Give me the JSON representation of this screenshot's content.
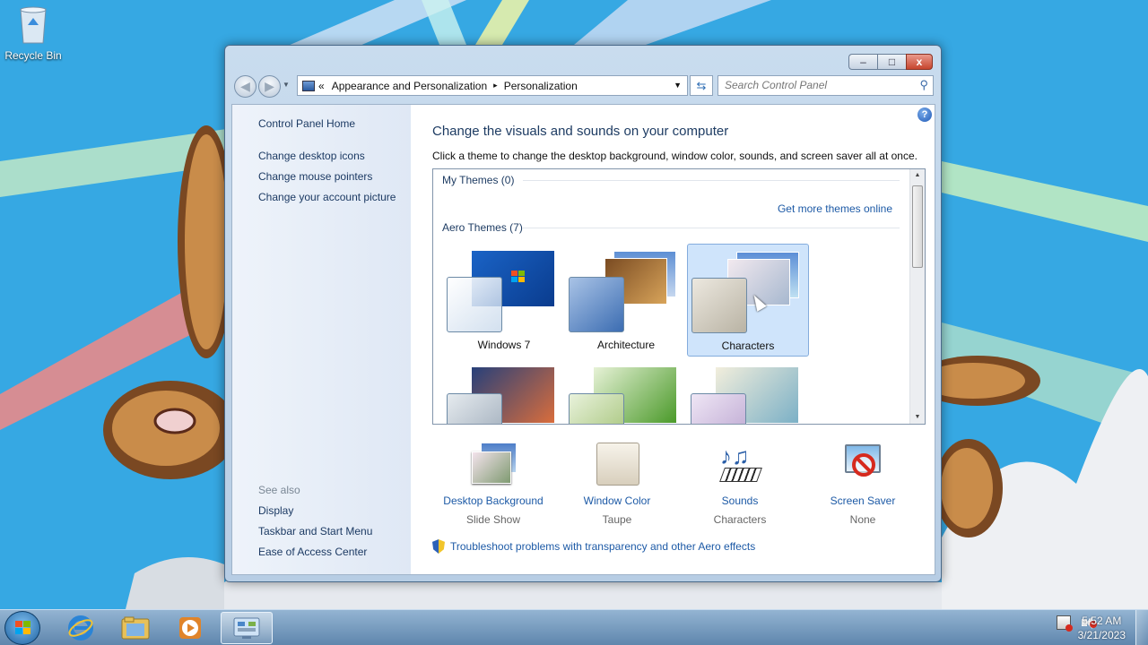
{
  "desktop": {
    "recycle_bin_label": "Recycle Bin"
  },
  "window": {
    "controls": {
      "minimize": "–",
      "maximize": "□",
      "close": "x"
    },
    "address": {
      "prefix": "«",
      "crumbs": [
        "Appearance and Personalization",
        "Personalization"
      ],
      "separator": "▸"
    },
    "search_placeholder": "Search Control Panel"
  },
  "sidebar": {
    "home": "Control Panel Home",
    "links": [
      "Change desktop icons",
      "Change mouse pointers",
      "Change your account picture"
    ],
    "see_also_label": "See also",
    "see_also": [
      "Display",
      "Taskbar and Start Menu",
      "Ease of Access Center"
    ]
  },
  "main": {
    "title": "Change the visuals and sounds on your computer",
    "subtitle": "Click a theme to change the desktop background, window color, sounds, and screen saver all at once.",
    "my_themes": "My Themes (0)",
    "get_more": "Get more themes online",
    "aero_themes": "Aero Themes (7)",
    "themes": [
      {
        "name": "Windows 7",
        "selected": false
      },
      {
        "name": "Architecture",
        "selected": false
      },
      {
        "name": "Characters",
        "selected": true
      }
    ],
    "bottom": [
      {
        "label": "Desktop Background",
        "value": "Slide Show",
        "icon": "desktop-background-icon"
      },
      {
        "label": "Window Color",
        "value": "Taupe",
        "icon": "window-color-icon"
      },
      {
        "label": "Sounds",
        "value": "Characters",
        "icon": "sounds-icon"
      },
      {
        "label": "Screen Saver",
        "value": "None",
        "icon": "screen-saver-icon"
      }
    ],
    "troubleshoot": "Troubleshoot problems with transparency and other Aero effects"
  },
  "taskbar": {
    "time": "5:52 AM",
    "date": "3/21/2023"
  }
}
